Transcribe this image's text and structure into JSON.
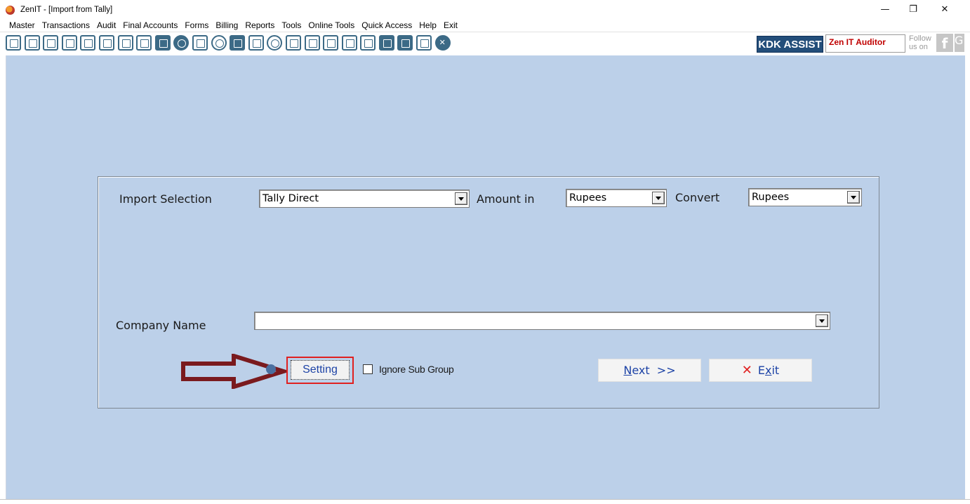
{
  "window": {
    "title": "ZenIT - [Import from Tally]",
    "minimize_glyph": "—",
    "restore_glyph": "❐",
    "close_glyph": "✕"
  },
  "menu": [
    "Master",
    "Transactions",
    "Audit",
    "Final Accounts",
    "Forms",
    "Billing",
    "Reports",
    "Tools",
    "Online Tools",
    "Quick Access",
    "Help",
    "Exit"
  ],
  "toolbar": {
    "icons": [
      "rupee-icon",
      "home-icon",
      "building-icon",
      "bar-chart-icon",
      "gift-icon",
      "users-icon",
      "pen-icon",
      "filter-icon",
      "tax-icon",
      "record-icon",
      "calculator-icon",
      "pie-chart-icon",
      "pay-icon",
      "book-icon",
      "info-icon",
      "report-icon",
      "user-doc-icon",
      "calendar-icon",
      "folder-icon",
      "search-doc-icon",
      "bs-icon",
      "bs-sch-icon",
      "3cd-icon",
      "close-circle-icon"
    ],
    "kdk_label": "KDK ASSIST",
    "zen_auditor_label": "Zen IT Auditor",
    "follow_label": "Follow us on",
    "facebook_glyph": "f",
    "google_glyph": "G",
    "accent_color": "#3c6a86"
  },
  "form": {
    "import_selection_label": "Import Selection",
    "import_selection_value": "Tally Direct",
    "amount_in_label": "Amount in",
    "amount_in_value": "Rupees",
    "convert_label": "Convert",
    "convert_value": "Rupees",
    "company_name_label": "Company Name",
    "company_name_value": "",
    "setting_label": "Setting",
    "ignore_sub_group_label": "Ignore Sub Group",
    "ignore_sub_group_checked": false,
    "next_button": {
      "mnemonic": "N",
      "rest": "ext  >>"
    },
    "exit_button": {
      "icon": "✕",
      "prefix": "E",
      "mnemonic": "x",
      "rest": "it"
    }
  },
  "colors": {
    "background": "#bcd0e9",
    "highlight_box": "#e02020",
    "arrow_annotation": "#7a1a1e",
    "button_text": "#1d43a6"
  }
}
